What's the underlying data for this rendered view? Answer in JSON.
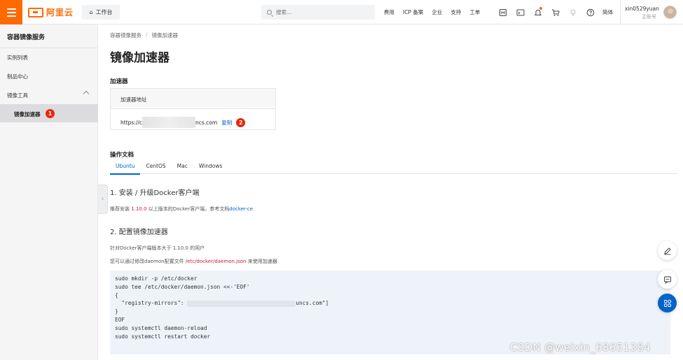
{
  "topbar": {
    "logo_text": "阿里云",
    "workbench_label": "工作台",
    "search_placeholder": "搜索...",
    "nav_links": [
      "费用",
      "ICP 备案",
      "企业",
      "支持",
      "工单"
    ],
    "lang_label": "简体",
    "user_name": "xin0529yuan",
    "user_role": "主账号",
    "accent_color": "#ff6a00"
  },
  "sidebar": {
    "title": "容器镜像服务",
    "items": [
      "实例列表",
      "制品中心",
      "镜像工具"
    ],
    "active_item": "镜像加速器",
    "active_badge": "1"
  },
  "main": {
    "breadcrumb": [
      "容器镜像服务",
      "镜像加速器"
    ],
    "breadcrumb_sep": "/",
    "page_title": "镜像加速器",
    "accelerator": {
      "section_title": "加速器",
      "column_header": "加速器地址",
      "url_prefix": "https://c",
      "url_suffix": "ncs.com",
      "copy_label": "复制",
      "copy_badge": "2"
    },
    "docs": {
      "section_title": "操作文档",
      "tabs": [
        "Ubuntu",
        "CentOS",
        "Mac",
        "Windows"
      ],
      "active_tab": "Ubuntu",
      "step1_title": "1. 安装 / 升级Docker客户端",
      "step1_text_a": "推荐安装 ",
      "step1_version": "1.10.0",
      "step1_text_b": " 以上版本的Docker客户端，参考文档",
      "step1_link": "docker-ce",
      "step2_title": "2. 配置镜像加速器",
      "step2_text1": "针对Docker客户端版本大于 1.10.0 的用户",
      "step2_text2_a": "您可以通过修改daemon配置文件 ",
      "step2_path": "/etc/docker/daemon.json",
      "step2_text2_b": " 来使用加速器",
      "code_lines": [
        "sudo mkdir -p /etc/docker",
        "sudo tee /etc/docker/daemon.json <<-'EOF'",
        "{",
        "  \"registry-mirrors\": ",
        "}",
        "EOF",
        "sudo systemctl daemon-reload",
        "sudo systemctl restart docker"
      ],
      "code_mirror_suffix": "uncs.com\"]"
    }
  },
  "watermark": "CSDN @weixin_68651384",
  "colors": {
    "link_blue": "#0064c8",
    "badge_red": "#e8260d",
    "code_bg": "#eef3fa"
  }
}
